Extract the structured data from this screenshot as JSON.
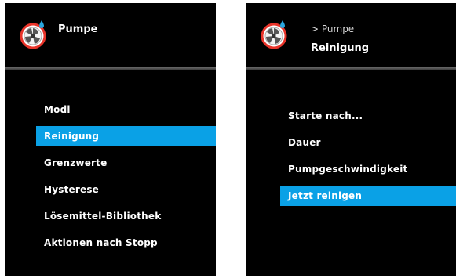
{
  "colors": {
    "screen_background": "#000000",
    "selection": "#0aa1e6",
    "text": "#ffffff",
    "icon_accent": "#e8342a",
    "icon_drop": "#29a8e0"
  },
  "left_screen": {
    "icon": "pump-icon",
    "title": "Pumpe",
    "menu_items": [
      {
        "label": "Modi",
        "selected": false
      },
      {
        "label": "Reinigung",
        "selected": true
      },
      {
        "label": "Grenzwerte",
        "selected": false
      },
      {
        "label": "Hysterese",
        "selected": false
      },
      {
        "label": "Lösemittel-Bibliothek",
        "selected": false
      },
      {
        "label": "Aktionen nach Stopp",
        "selected": false
      }
    ]
  },
  "right_screen": {
    "icon": "pump-icon",
    "breadcrumb": "> Pumpe",
    "title": "Reinigung",
    "menu_items": [
      {
        "label": "Starte nach...",
        "selected": false
      },
      {
        "label": "Dauer",
        "selected": false
      },
      {
        "label": "Pumpgeschwindigkeit",
        "selected": false
      },
      {
        "label": "Jetzt reinigen",
        "selected": true
      }
    ]
  }
}
